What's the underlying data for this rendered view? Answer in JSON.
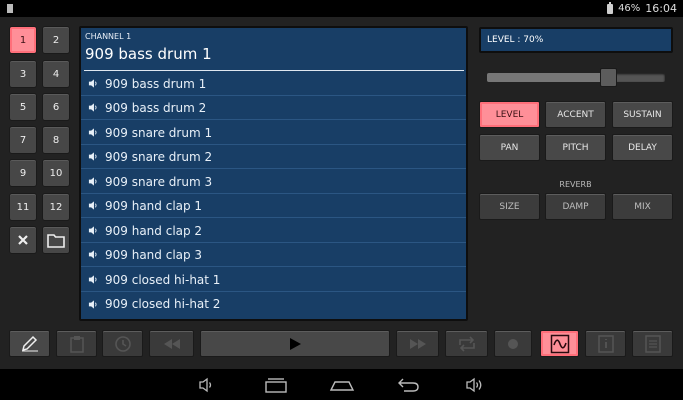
{
  "status": {
    "battery": "46%",
    "time": "16:04"
  },
  "channels": [
    "1",
    "2",
    "3",
    "4",
    "5",
    "6",
    "7",
    "8",
    "9",
    "10",
    "11",
    "12"
  ],
  "selected_channel": "1",
  "channel_actions": {
    "delete_icon": "close-icon",
    "open_icon": "folder-icon"
  },
  "panel": {
    "header_small": "CHANNEL 1",
    "header_big": "909 bass drum 1",
    "sounds": [
      "909 bass drum 1",
      "909 bass drum 2",
      "909 snare drum 1",
      "909 snare drum 2",
      "909 snare drum 3",
      "909 hand clap 1",
      "909 hand clap 2",
      "909 hand clap 3",
      "909 closed hi-hat 1",
      "909 closed hi-hat 2"
    ]
  },
  "level": {
    "label": "LEVEL : 70%",
    "value": 0.7
  },
  "params": {
    "row1": [
      "LEVEL",
      "ACCENT",
      "SUSTAIN"
    ],
    "row2": [
      "PAN",
      "PITCH",
      "DELAY"
    ],
    "reverb_label": "REVERB",
    "row3": [
      "SIZE",
      "DAMP",
      "MIX"
    ],
    "active": "LEVEL"
  },
  "colors": {
    "accent": "#ff8f98",
    "panel": "#183e66"
  }
}
